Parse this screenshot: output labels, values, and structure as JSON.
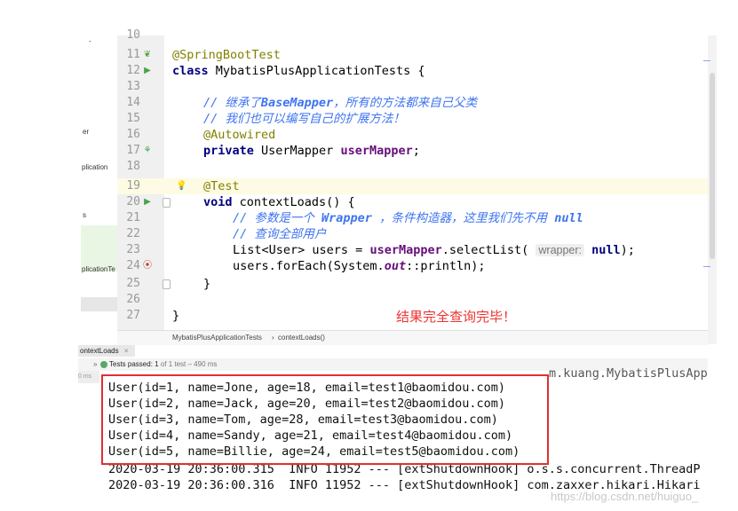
{
  "left_panel": {
    "fragments": [
      "er",
      "plication",
      "s",
      "plicationTe"
    ]
  },
  "editor": {
    "lines": [
      {
        "num": "10"
      },
      {
        "num": "11",
        "icon": "leaf-icon",
        "code": "@SpringBootTest"
      },
      {
        "num": "12",
        "icon": "run-test-icon",
        "code_kw": "class ",
        "code_rest": "MybatisPlusApplicationTests {"
      },
      {
        "num": "13"
      },
      {
        "num": "14",
        "comment_a": "// 继承了",
        "comment_b": "BaseMapper",
        "comment_c": "，所有的方法都来自己父类"
      },
      {
        "num": "15",
        "comment": "// 我们也可以编写自己的扩展方法！"
      },
      {
        "num": "16",
        "annotation": "@Autowired"
      },
      {
        "num": "17",
        "icon": "bean-icon",
        "kw": "private ",
        "type": "UserMapper ",
        "field": "userMapper",
        "end": ";"
      },
      {
        "num": "18"
      },
      {
        "num": "19",
        "icon": "bulb-icon",
        "annotation": "@Test"
      },
      {
        "num": "20",
        "icon": "run-test-icon",
        "kw": "void ",
        "rest": "contextLoads() {"
      },
      {
        "num": "21",
        "comment_a": "// 参数是一个 ",
        "comment_b": "Wrapper",
        "comment_c": " ，条件构造器，这里我们先不用 ",
        "comment_d": "null"
      },
      {
        "num": "22",
        "comment": "// 查询全部用户"
      },
      {
        "num": "23",
        "pre": "List<User> users = ",
        "field": "userMapper",
        "mid": ".selectList( ",
        "hint": "wrapper:",
        "null_kw": " null",
        "end": ");"
      },
      {
        "num": "24",
        "icon": "breakpoint-icon",
        "pre": "users.forEach(System.",
        "static": "out",
        "end": "::println);"
      },
      {
        "num": "25",
        "code": "}"
      },
      {
        "num": "26"
      },
      {
        "num": "27",
        "code": "}"
      }
    ],
    "result_note": "结果完全查询完毕！"
  },
  "breadcrumb": {
    "class_name": "MybatisPlusApplicationTests",
    "separator": "›",
    "method_name": "contextLoads()"
  },
  "run_panel": {
    "tab_label": "ontextLoads",
    "tab_close": "×",
    "expand_glyph": "»",
    "status_prefix": "Tests passed:",
    "status_count": " 1",
    "status_suffix": " of 1 test – 490 ms",
    "time_label": "0 ms",
    "cut_line": "m.kuang.MybatisPlusApp"
  },
  "console": {
    "users": [
      "User(id=1, name=Jone, age=18, email=test1@baomidou.com)",
      "User(id=2, name=Jack, age=20, email=test2@baomidou.com)",
      "User(id=3, name=Tom, age=28, email=test3@baomidou.com)",
      "User(id=4, name=Sandy, age=21, email=test4@baomidou.com)",
      "User(id=5, name=Billie, age=24, email=test5@baomidou.com)"
    ],
    "logs": [
      "2020-03-19 20:36:00.315  INFO 11952 --- [extShutdownHook] o.s.s.concurrent.ThreadP",
      "2020-03-19 20:36:00.316  INFO 11952 --- [extShutdownHook] com.zaxxer.hikari.Hikari"
    ]
  },
  "watermark": "https://blog.csdn.net/huiguo_",
  "colors": {
    "keyword": "#000080",
    "annotation": "#808000",
    "comment": "#3e74f0",
    "field": "#660e7a",
    "result_note": "#ee3333",
    "highlight_box": "#e03030",
    "test_passed": "#59a869"
  }
}
